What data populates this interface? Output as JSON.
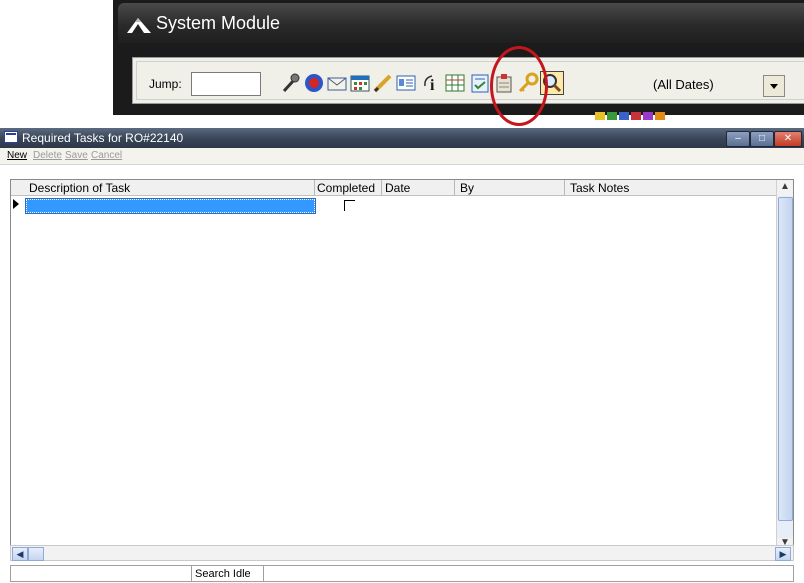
{
  "system_module": {
    "title": "System Module",
    "jump_label": "Jump:",
    "jump_value": "",
    "toolbar_icons": [
      "microphone-icon",
      "globe-icon",
      "envelope-icon",
      "calendar-grid-icon",
      "pen-icon",
      "contact-card-icon",
      "info-icon",
      "spreadsheet-icon",
      "required-tasks-icon",
      "clipboard-icon",
      "key-icon",
      "search-magnifier-icon"
    ],
    "date_filter": "(All Dates)",
    "highlight_color": "#c4161c"
  },
  "dialog": {
    "title": "Required Tasks for RO#22140",
    "menu": {
      "new": "New",
      "delete": "Delete",
      "save": "Save",
      "cancel": "Cancel"
    },
    "columns": [
      "Description of Task",
      "Completed",
      "Date",
      "By",
      "Task Notes"
    ],
    "rows": [
      {
        "description": "",
        "completed": false,
        "date": "",
        "by": "",
        "notes": ""
      }
    ],
    "status": "Search Idle",
    "selection_color": "#3399ff"
  }
}
